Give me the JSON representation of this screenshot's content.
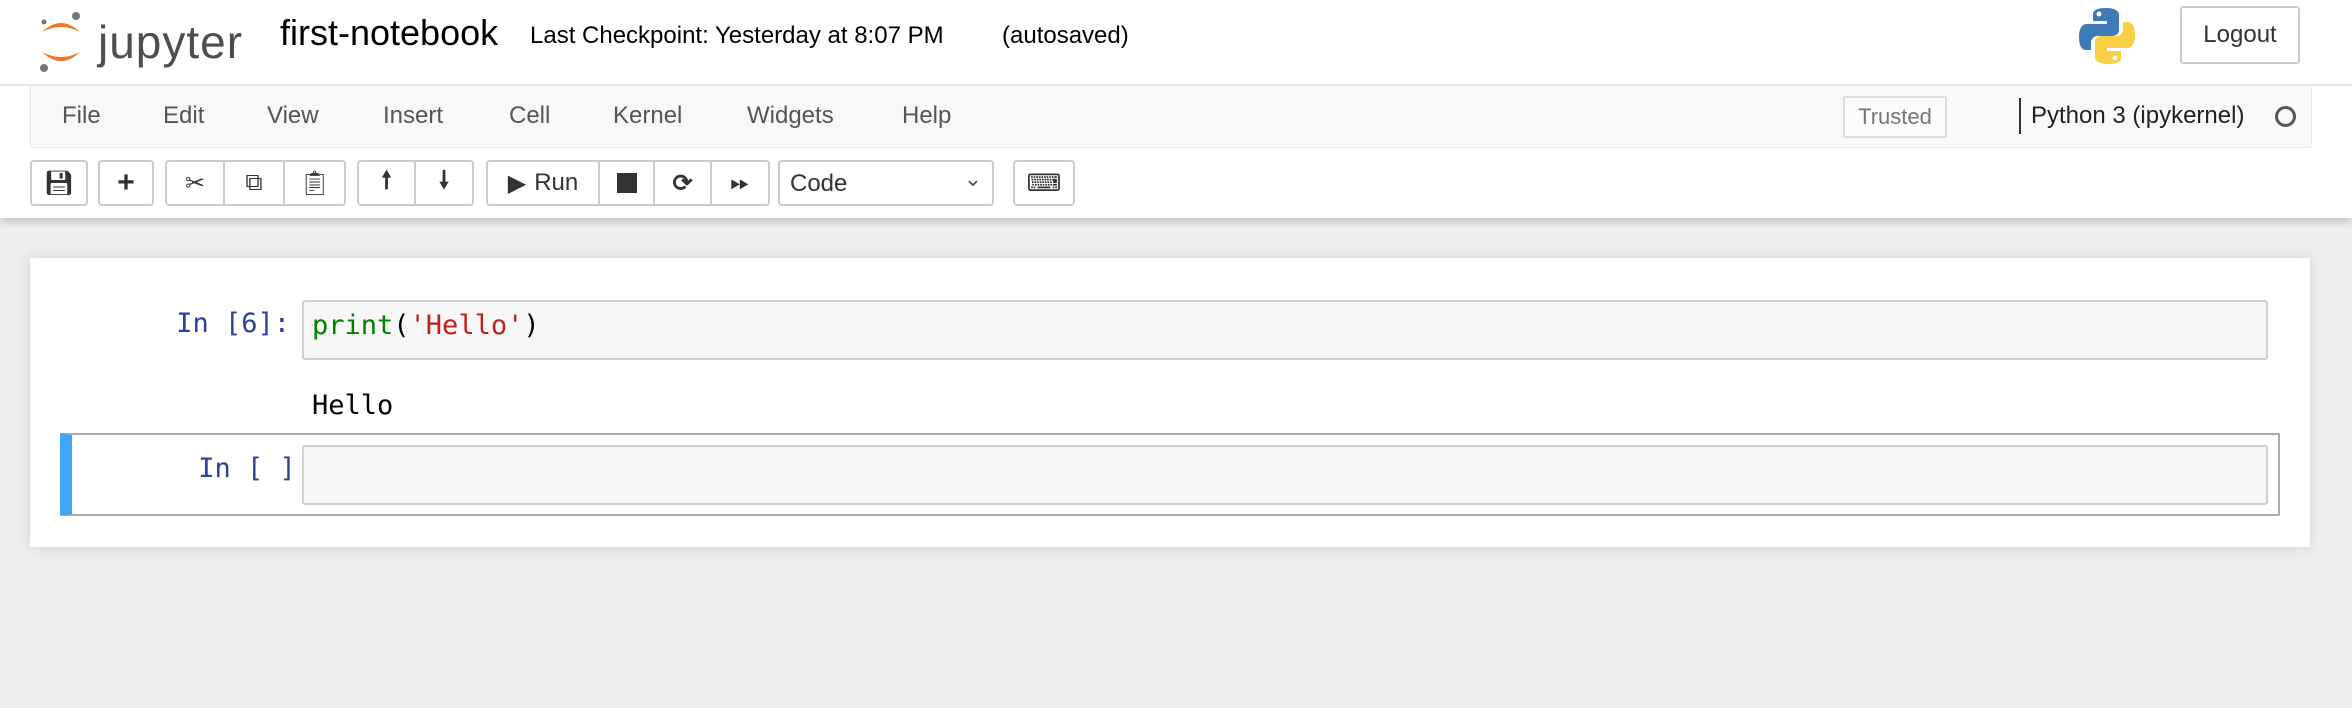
{
  "header": {
    "logo_text": "jupyter",
    "notebook_title": "first-notebook",
    "checkpoint": "Last Checkpoint: Yesterday at 8:07 PM",
    "autosave_status": "(autosaved)",
    "logout_label": "Logout"
  },
  "menubar": {
    "items": [
      "File",
      "Edit",
      "View",
      "Insert",
      "Cell",
      "Kernel",
      "Widgets",
      "Help"
    ],
    "trusted": "Trusted",
    "kernel_name": "Python 3 (ipykernel)",
    "kernel_status": "idle"
  },
  "toolbar": {
    "run_label": "Run",
    "cell_type": "Code",
    "icons": [
      "save-icon",
      "plus-icon",
      "cut-icon",
      "copy-icon",
      "paste-icon",
      "arrow-up-icon",
      "arrow-down-icon",
      "play-icon",
      "stop-icon",
      "restart-icon",
      "fast-forward-icon",
      "keyboard-icon"
    ]
  },
  "cells": [
    {
      "prompt": "In [6]:",
      "code_func": "print",
      "code_open": "(",
      "code_string": "'Hello'",
      "code_close": ")",
      "output": "Hello"
    },
    {
      "prompt": "In [ ]:",
      "code": "",
      "selected": true
    }
  ],
  "colors": {
    "accent": "#42a5f5",
    "prompt": "#303f9f",
    "keyword": "#008000",
    "string": "#ba2121",
    "logo_orange": "#f37726"
  }
}
